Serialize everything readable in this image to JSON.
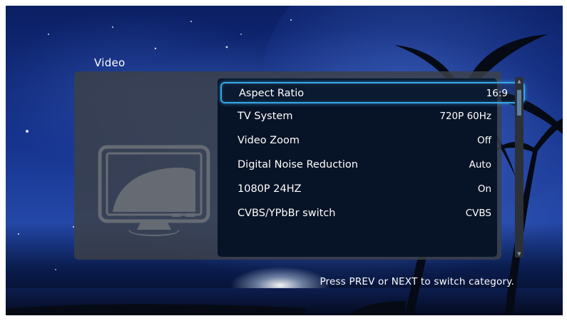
{
  "category": {
    "title": "Video"
  },
  "settings": [
    {
      "label": "Aspect Ratio",
      "value": "16:9",
      "selected": true
    },
    {
      "label": "TV System",
      "value": "720P 60Hz"
    },
    {
      "label": "Video Zoom",
      "value": "Off"
    },
    {
      "label": "Digital Noise Reduction",
      "value": "Auto"
    },
    {
      "label": "1080P 24HZ",
      "value": "On"
    },
    {
      "label": "CVBS/YPbBr switch",
      "value": "CVBS"
    }
  ],
  "hint": "Press PREV or NEXT to switch category.",
  "icons": {
    "preview": "tv-monitor-icon",
    "scroll_up": "scroll-up-arrow-icon",
    "scroll_down": "scroll-down-arrow-icon"
  },
  "colors": {
    "highlight": "#39a6e6",
    "list_background": "#071326",
    "panel": "#3c4048"
  }
}
